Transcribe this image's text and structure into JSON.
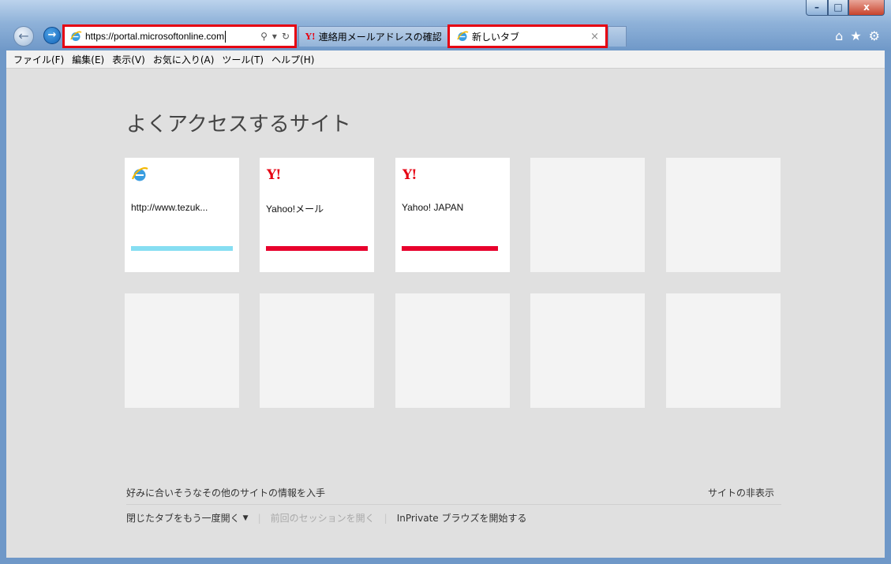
{
  "address_bar": {
    "url": "https://portal.microsoftonline.com"
  },
  "tabs": [
    {
      "label": "連絡用メールアドレスの確認 ...",
      "icon": "yahoo-icon",
      "active": false
    },
    {
      "label": "新しいタブ",
      "icon": "ie-icon",
      "active": true,
      "close": "×"
    }
  ],
  "menu": [
    {
      "label": "ファイル(F)"
    },
    {
      "label": "編集(E)"
    },
    {
      "label": "表示(V)"
    },
    {
      "label": "お気に入り(A)"
    },
    {
      "label": "ツール(T)"
    },
    {
      "label": "ヘルプ(H)"
    }
  ],
  "new_tab_page": {
    "heading": "よくアクセスするサイト",
    "tiles": [
      {
        "title": "http://www.tezuk...",
        "icon": "ie-icon",
        "bar_color": "#86def2"
      },
      {
        "title": "Yahoo!メール",
        "icon": "yahoo-icon",
        "logo_text": "Y!",
        "bar_color": "#e8002c"
      },
      {
        "title": "Yahoo! JAPAN",
        "icon": "yahoo-icon",
        "logo_text": "Y!",
        "bar_color": "#e8002c"
      }
    ],
    "footer": {
      "suggest_text": "好みに合いそうなその他のサイトの情報を入手",
      "hide_sites": "サイトの非表示",
      "reopen_tabs": "閉じたタブをもう一度開く",
      "reopen_session": "前回のセッションを開く",
      "inprivate": "InPrivate ブラウズを開始する"
    }
  },
  "colors": {
    "highlight_border": "#e60012",
    "content_bg": "#e0e0e0"
  }
}
